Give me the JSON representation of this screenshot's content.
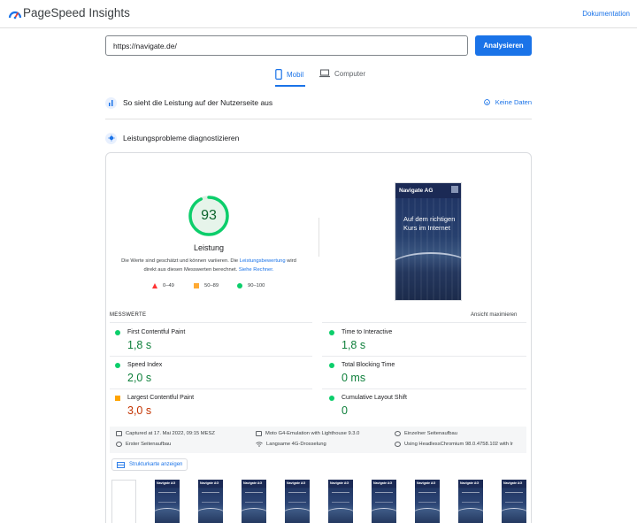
{
  "header": {
    "brand": "PageSpeed Insights",
    "docs_link": "Dokumentation"
  },
  "search": {
    "url": "https://navigate.de/",
    "analyze_label": "Analysieren"
  },
  "tabs": [
    {
      "label": "Mobil",
      "icon": "smartphone-icon",
      "selected": true
    },
    {
      "label": "Computer",
      "icon": "laptop-icon",
      "selected": false
    }
  ],
  "field_section": {
    "title": "So sieht die Leistung auf der Nutzerseite aus",
    "no_data_label": "Keine Daten"
  },
  "diagnose_section": {
    "title": "Leistungsprobleme diagnostizieren"
  },
  "performance": {
    "score": "93",
    "label": "Leistung",
    "note_prefix": "Die Werte sind geschätzt und können variieren. Die ",
    "note_link1": "Leistungsbewertung",
    "note_middle": " wird direkt aus diesen Messwerten berechnet. ",
    "note_link2": "Siehe Rechner.",
    "legend": [
      {
        "range": "0–49",
        "color": "#ff3333"
      },
      {
        "range": "50–89",
        "color": "#ffaa33"
      },
      {
        "range": "90–100",
        "color": "#0cce6b"
      }
    ]
  },
  "screenshot": {
    "logo": "Navigate AG",
    "headline": "Auf dem richtigen Kurs im Internet"
  },
  "metrics": {
    "section_label": "MESSWERTE",
    "expand_label": "Ansicht maximieren",
    "items": [
      {
        "name": "First Contentful Paint",
        "value": "1,8 s",
        "status": "good",
        "color": "#0d7f3a"
      },
      {
        "name": "Time to Interactive",
        "value": "1,8 s",
        "status": "good",
        "color": "#0d7f3a"
      },
      {
        "name": "Speed Index",
        "value": "2,0 s",
        "status": "good",
        "color": "#0d7f3a"
      },
      {
        "name": "Total Blocking Time",
        "value": "0 ms",
        "status": "good",
        "color": "#0d7f3a"
      },
      {
        "name": "Largest Contentful Paint",
        "value": "3,0 s",
        "status": "average",
        "color": "#c33300"
      },
      {
        "name": "Cumulative Layout Shift",
        "value": "0",
        "status": "good",
        "color": "#0d7f3a"
      }
    ]
  },
  "run_info": {
    "captured": "Captured at 17. Mai 2022, 09:15 MESZ",
    "device": "Moto G4-Emulation with Lighthouse 9.3.0",
    "load": "Einzelner Seitenaufbau",
    "initial": "Erster Seitenaufbau",
    "throttling": "Langsame 4G-Drosselung",
    "browser": "Using HeadlessChromium 98.0.4758.102 with lr"
  },
  "treemap_button": "Strukturkarte anzeigen",
  "filmstrip": {
    "frame_logo": "Navigate AG"
  },
  "colors": {
    "accent": "#1a73e8",
    "good": "#0cce6b",
    "average": "#ffa400",
    "poor": "#ff3333"
  }
}
